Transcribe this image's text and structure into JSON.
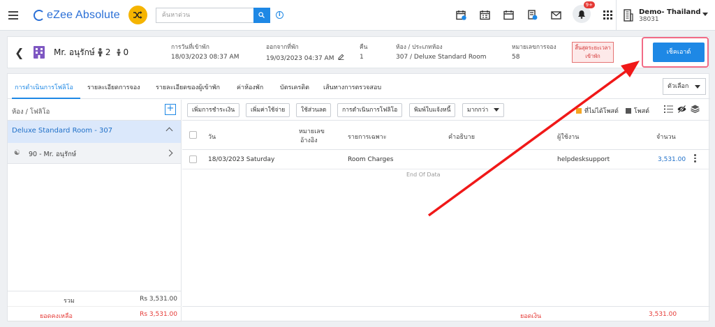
{
  "app": {
    "title": "eZee Absolute"
  },
  "search": {
    "placeholder": "ค้นหาด่วน"
  },
  "hotel": {
    "name": "Demo- Thailand",
    "code": "38031"
  },
  "notifications": {
    "badge": "9+"
  },
  "guest": {
    "name": "Mr. อนุรักษ์",
    "adults": "2",
    "children": "0",
    "arrival_label": "การวันที่เข้าพัก",
    "arrival_value": "18/03/2023 08:37 AM",
    "departure_label": "ออกจากที่พัก",
    "departure_value": "19/03/2023 04:37 AM",
    "nights_label": "คืน",
    "nights_value": "1",
    "room_label": "ห้อง / ประเภทห้อง",
    "room_value": "307 / Deluxe Standard Room",
    "booking_label": "หมายเลขการจอง",
    "booking_value": "58",
    "warning_line1": "สิ้นสุดระยะเวลา",
    "warning_line2": "เข้าพัก",
    "checkout_label": "เช็คเอาต์"
  },
  "tabs": [
    {
      "label": "การดำเนินการโฟลิโอ"
    },
    {
      "label": "รายละเอียดการจอง"
    },
    {
      "label": "รายละเอียดของผู้เข้าพัก"
    },
    {
      "label": "ค่าห้องพัก"
    },
    {
      "label": "บัตรเครดิต"
    },
    {
      "label": "เส้นทางการตรวจสอบ"
    }
  ],
  "options_select": "ตัวเลือก",
  "left_panel": {
    "header": "ห้อง / โฟลิโอ",
    "room": "Deluxe Standard Room - 307",
    "folio": "90 - Mr. อนุรักษ์",
    "total_label": "รวม",
    "total_value": "Rs 3,531.00",
    "remaining_label": "ยอดคงเหลือ",
    "remaining_value": "Rs 3,531.00"
  },
  "toolbar": {
    "add_payment": "เพิ่มการชำระเงิน",
    "add_charge": "เพิ่มค่าใช้จ่าย",
    "apply_discount": "ใช้ส่วนลด",
    "folio_ops": "การดำเนินการโฟลิโอ",
    "print_invoice": "พิมพ์ใบแจ้งหนี้",
    "more": "มากกว่า",
    "legend_unposted": "ที่ไม่ได้โพสต์",
    "legend_posted": "โพสต์"
  },
  "table": {
    "col_date": "วัน",
    "col_ref_line1": "หมายเลข",
    "col_ref_line2": "อ้างอิง",
    "col_particulars": "รายการเฉพาะ",
    "col_description": "คำอธิบาย",
    "col_user": "ผู้ใช้งาน",
    "col_amount": "จำนวน",
    "rows": [
      {
        "date": "18/03/2023 Saturday",
        "ref": "",
        "particulars": "Room Charges",
        "description": "",
        "user": "helpdesksupport",
        "amount": "3,531.00"
      }
    ],
    "end_of_data": "End Of Data",
    "balance_label": "ยอดเงิน",
    "balance_value": "3,531.00"
  },
  "colors": {
    "accent": "#1e88e5",
    "warning": "#e53935",
    "highlight": "#f26b86",
    "logo_badge": "#f5b400"
  }
}
